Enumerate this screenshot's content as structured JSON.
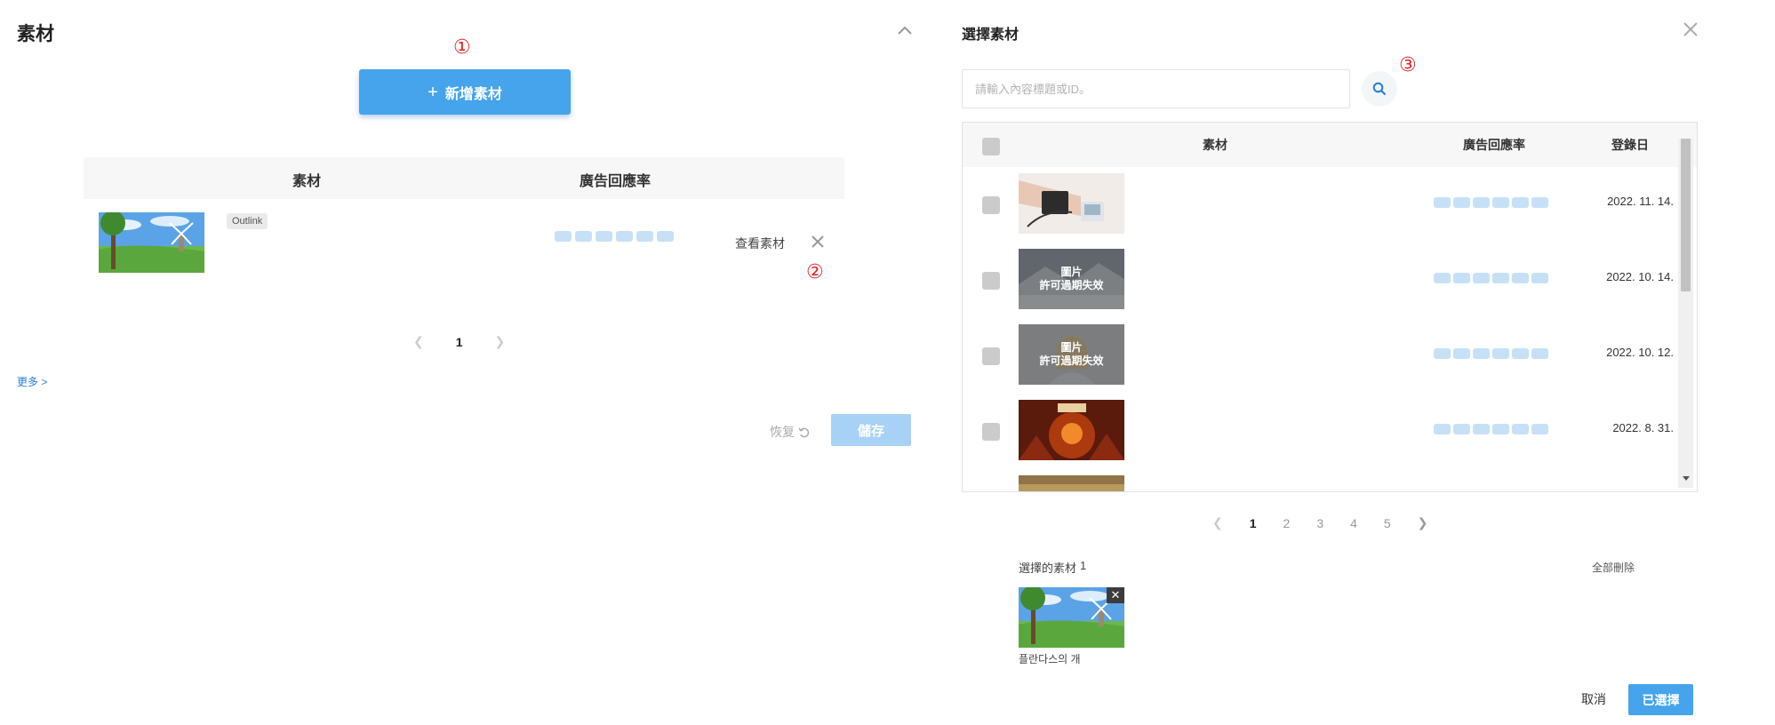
{
  "left": {
    "title": "素材",
    "marker1": "①",
    "marker2": "②",
    "add_button": "新增素材",
    "columns": {
      "material": "素材",
      "response": "廣告回應率"
    },
    "row": {
      "badge": "Outlink",
      "view_button": "查看素材"
    },
    "pagination": {
      "current": "1"
    },
    "more_link": "更多 >",
    "reset_button": "恢复",
    "save_button": "儲存"
  },
  "right": {
    "title": "選擇素材",
    "marker3": "③",
    "search": {
      "placeholder": "請輸入內容標題或ID。",
      "value": ""
    },
    "columns": {
      "material": "素材",
      "response": "廣告回應率",
      "date": "登錄日"
    },
    "rows": [
      {
        "date": "2022. 11. 14."
      },
      {
        "date": "2022. 10. 14.",
        "overlay_line1": "圖片",
        "overlay_line2": "許可過期失效"
      },
      {
        "date": "2022. 10. 12.",
        "overlay_line1": "圖片",
        "overlay_line2": "許可過期失效"
      },
      {
        "date": "2022. 8. 31."
      }
    ],
    "pagination": {
      "pages": [
        "1",
        "2",
        "3",
        "4",
        "5"
      ],
      "current": "1"
    },
    "selected": {
      "label": "選擇的素材",
      "count": "1",
      "delete_all": "全部刪除",
      "item_name": "플란다스의 개"
    },
    "cancel_button": "取消",
    "confirm_button": "已選擇"
  },
  "colors": {
    "accent": "#45a4ec",
    "accent_light": "#a7d2f5",
    "marker": "#e0252b",
    "bar": "#c6e1f6"
  }
}
